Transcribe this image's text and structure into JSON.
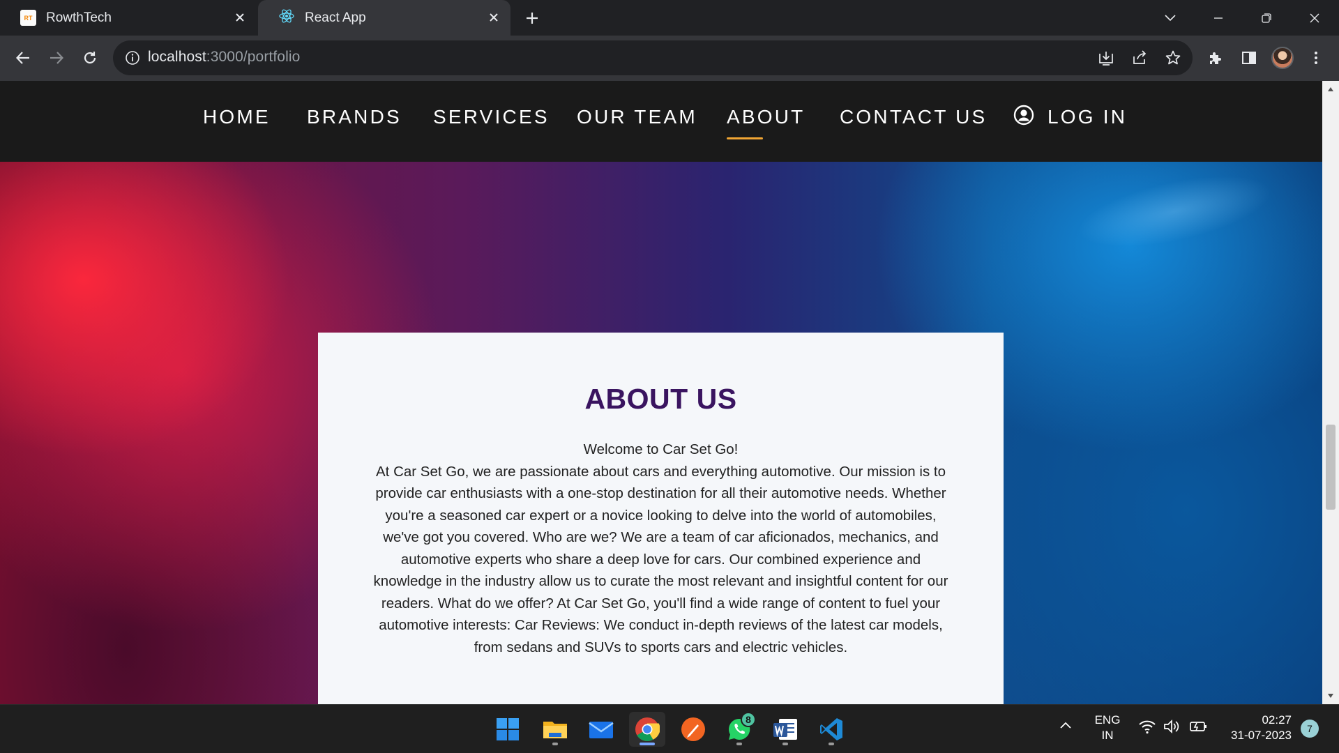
{
  "browser": {
    "tabs": [
      {
        "title": "RowthTech",
        "favicon_text": "RT",
        "active": false
      },
      {
        "title": "React App",
        "active": true
      }
    ],
    "address": {
      "host": "localhost",
      "path": ":3000/portfolio"
    }
  },
  "site": {
    "nav": [
      {
        "label": "HOME"
      },
      {
        "label": "BRANDS"
      },
      {
        "label": "SERVICES"
      },
      {
        "label": "OUR TEAM"
      },
      {
        "label": "ABOUT",
        "active": true
      },
      {
        "label": "CONTACT US"
      },
      {
        "label": "LOG IN",
        "icon": "user-circle-icon"
      }
    ],
    "accent": "#f0a534",
    "about": {
      "title": "ABOUT US",
      "title_color": "#3a1460",
      "body": "Welcome to Car Set Go!\nAt Car Set Go, we are passionate about cars and everything automotive. Our mission is to provide car enthusiasts with a one-stop destination for all their automotive needs. Whether you're a seasoned car expert or a novice looking to delve into the world of automobiles, we've got you covered. Who are we? We are a team of car aficionados, mechanics, and automotive experts who share a deep love for cars. Our combined experience and knowledge in the industry allow us to curate the most relevant and insightful content for our readers. What do we offer? At Car Set Go, you'll find a wide range of content to fuel your automotive interests: Car Reviews: We conduct in-depth reviews of the latest car models, from sedans and SUVs to sports cars and electric vehicles."
    }
  },
  "taskbar": {
    "apps": [
      "windows-start-icon",
      "file-explorer-icon",
      "mail-icon",
      "chrome-icon",
      "paint-icon",
      "whatsapp-icon",
      "word-icon",
      "vscode-icon"
    ],
    "whatsapp_badge": "8",
    "language": {
      "line1": "ENG",
      "line2": "IN"
    },
    "clock": {
      "time": "02:27",
      "date": "31-07-2023"
    },
    "notifications": "7"
  }
}
